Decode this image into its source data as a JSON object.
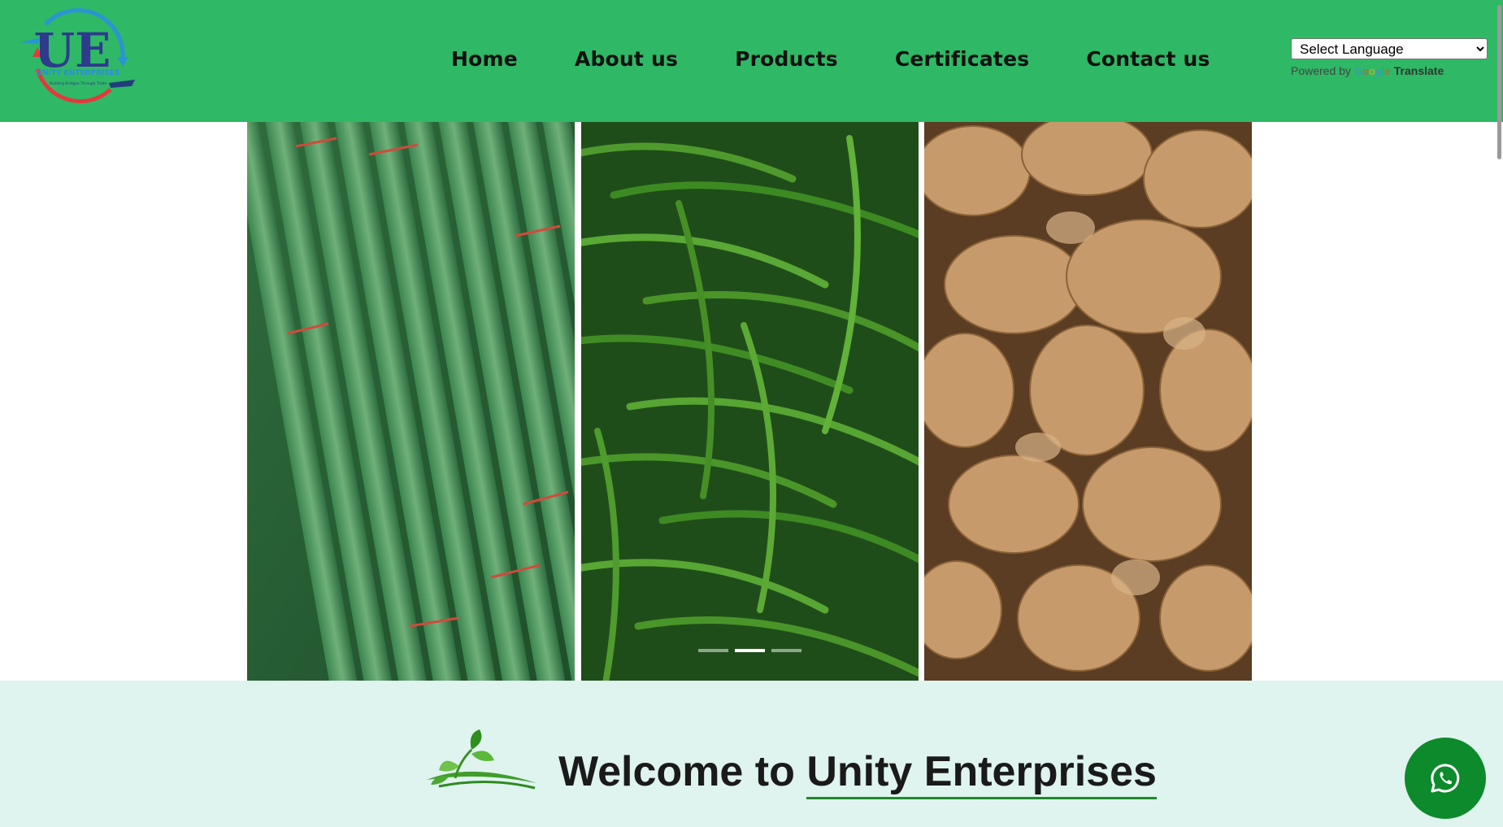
{
  "header": {
    "logo": {
      "initials": "UE",
      "name": "UNITY ENTERPRISES",
      "tagline": "Building Bridges Through Trade"
    },
    "nav": [
      {
        "label": "Home"
      },
      {
        "label": "About us"
      },
      {
        "label": "Products"
      },
      {
        "label": "Certificates"
      },
      {
        "label": "Contact us"
      }
    ],
    "language": {
      "selected": "Select Language",
      "powered_by": "Powered by",
      "google": "Google",
      "translate": "Translate"
    }
  },
  "carousel": {
    "slides": [
      {
        "subject": "drumsticks"
      },
      {
        "subject": "green chillies"
      },
      {
        "subject": "ginger"
      }
    ],
    "indicator_count": 3,
    "active_index": 1
  },
  "welcome": {
    "prefix": "Welcome to",
    "brand": "Unity Enterprises"
  },
  "whatsapp": {
    "icon": "whatsapp-icon"
  },
  "colors": {
    "header_bg": "#2fb866",
    "welcome_bg": "#dff3ef",
    "whatsapp_bg": "#0d8a2c",
    "accent_underline": "#1f8a2b"
  }
}
